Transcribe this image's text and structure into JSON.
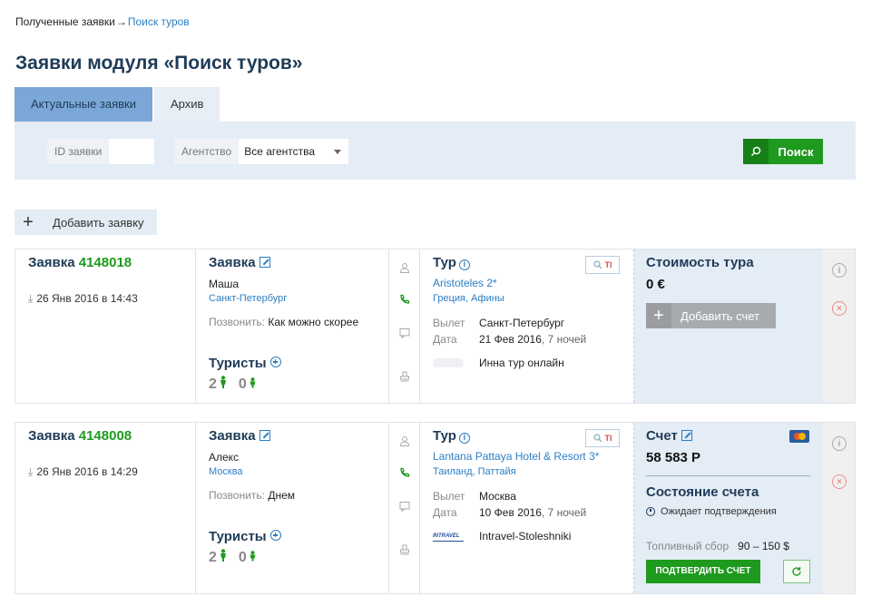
{
  "breadcrumb": {
    "parent": "Полученные заявки",
    "separator": "→",
    "current": "Поиск туров"
  },
  "page_title": "Заявки модуля «Поиск туров»",
  "tabs": [
    {
      "label": "Актуальные заявки",
      "active": true
    },
    {
      "label": "Архив",
      "active": false
    }
  ],
  "filters": {
    "id_label": "ID заявки",
    "id_value": "",
    "agency_label": "Агентство",
    "agency_value": "Все агентства",
    "search_label": "Поиск"
  },
  "add_order_label": "Добавить заявку",
  "labels": {
    "order": "Заявка",
    "request": "Заявка",
    "call": "Позвонить:",
    "tourists": "Туристы",
    "tour": "Тур",
    "departure": "Вылет",
    "date": "Дата",
    "tour_cost": "Стоимость тура",
    "add_invoice": "Добавить счет",
    "invoice": "Счет",
    "invoice_status": "Состояние счета",
    "fuel": "Топливный сбор",
    "confirm_invoice": "ПОДТВЕРДИТЬ СЧЕТ",
    "search_tools_t": "TI"
  },
  "orders": [
    {
      "number": "4148018",
      "created": "26 Янв 2016 в 14:43",
      "client_name": "Маша",
      "client_city": "Санкт-Петербург",
      "call_time": "Как можно скорее",
      "adults": "2",
      "children": "0",
      "hotel": "Aristoteles 2*",
      "country": "Греция, Афины",
      "departure": "Санкт-Петербург",
      "date": "21 Фев 2016",
      "nights": ", 7 ночей",
      "operator": "Инна тур онлайн",
      "price": "0 €"
    },
    {
      "number": "4148008",
      "created": "26 Янв 2016 в 14:29",
      "client_name": "Алекс",
      "client_city": "Москва",
      "call_time": "Днем",
      "adults": "2",
      "children": "0",
      "hotel": "Lantana Pattaya Hotel & Resort 3*",
      "country": "Таиланд, Паттайя",
      "departure": "Москва",
      "date": "10 Фев 2016",
      "nights": ", 7 ночей",
      "operator": "Intravel-Stoleshniki",
      "operator_logo_text": "INTRAVEL",
      "invoice_amount": "58 583 Р",
      "invoice_status": "Ожидает подтверждения",
      "fuel_charge": "90 – 150 $"
    }
  ],
  "colors": {
    "accent": "#2a7fc4",
    "green": "#1e9a1e",
    "panel": "#e4ecf5",
    "title": "#1f3b57"
  },
  "icons": [
    "search-icon",
    "edit-icon",
    "info-icon",
    "plus-circle-icon",
    "person-icon",
    "phone-icon",
    "comment-icon",
    "user-icon",
    "stamp-icon",
    "clock-icon",
    "refresh-icon",
    "close-icon",
    "mastercard-icon",
    "download-icon"
  ]
}
